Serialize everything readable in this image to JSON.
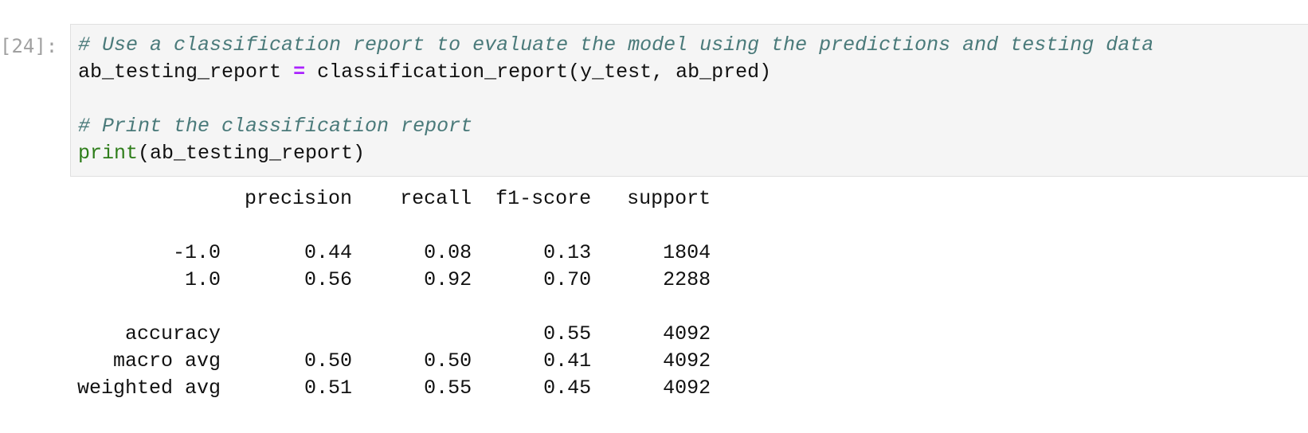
{
  "cell": {
    "prompt": "[24]:",
    "code": {
      "line1_comment": "# Use a classification report to evaluate the model using the predictions and testing data",
      "line2_var": "ab_testing_report",
      "line2_op": "=",
      "line2_call": "classification_report(y_test, ab_pred)",
      "line4_comment": "# Print the classification report",
      "line5_builtin": "print",
      "line5_args": "(ab_testing_report)"
    },
    "output": {
      "header": "              precision    recall  f1-score   support",
      "row_neg": "        -1.0       0.44      0.08      0.13      1804",
      "row_pos": "         1.0       0.56      0.92      0.70      2288",
      "row_accuracy": "    accuracy                           0.55      4092",
      "row_macro": "   macro avg       0.50      0.50      0.41      4092",
      "row_weighted": "weighted avg       0.51      0.55      0.45      4092"
    }
  }
}
